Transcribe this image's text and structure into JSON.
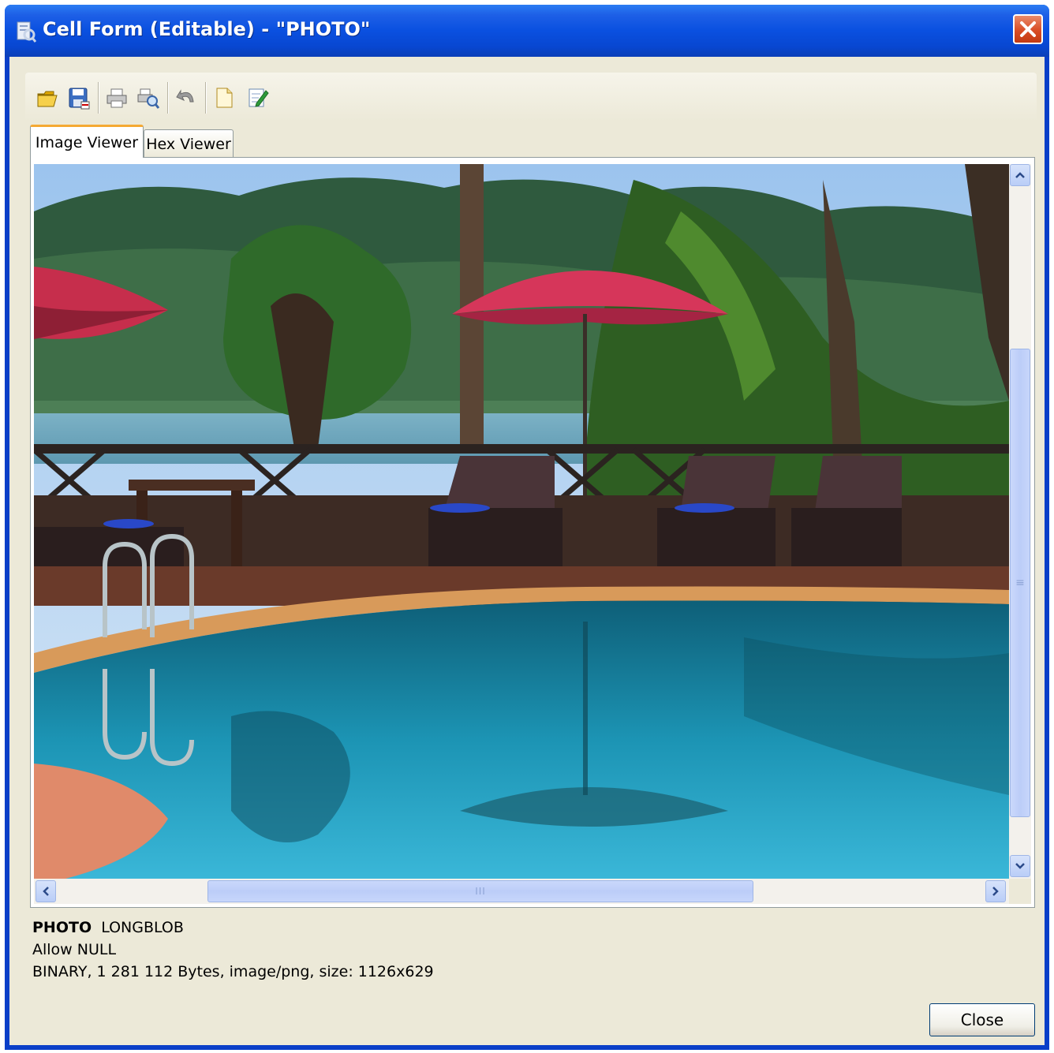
{
  "window": {
    "title": "Cell Form (Editable) - \"PHOTO\"",
    "title_bar_color": "#0a50e0",
    "close_button_color": "#d94d25"
  },
  "toolbar": {
    "buttons": [
      {
        "icon": "open-folder-icon"
      },
      {
        "icon": "save-icon"
      },
      {
        "icon": "print-icon"
      },
      {
        "icon": "print-preview-icon"
      },
      {
        "icon": "undo-icon"
      },
      {
        "icon": "new-document-icon"
      },
      {
        "icon": "edit-document-icon"
      }
    ]
  },
  "tabs": [
    {
      "label": "Image Viewer",
      "active": true
    },
    {
      "label": "Hex Viewer",
      "active": false
    }
  ],
  "viewer": {
    "content": "photo"
  },
  "scrollbars": {
    "vertical_grip": "≡",
    "horizontal_grip": "III"
  },
  "info": {
    "field_name": "PHOTO",
    "field_type": "LONGBLOB",
    "nullability": "Allow NULL",
    "details": "BINARY, 1 281 112 Bytes, image/png, size: 1126x629"
  },
  "footer": {
    "close_label": "Close"
  }
}
